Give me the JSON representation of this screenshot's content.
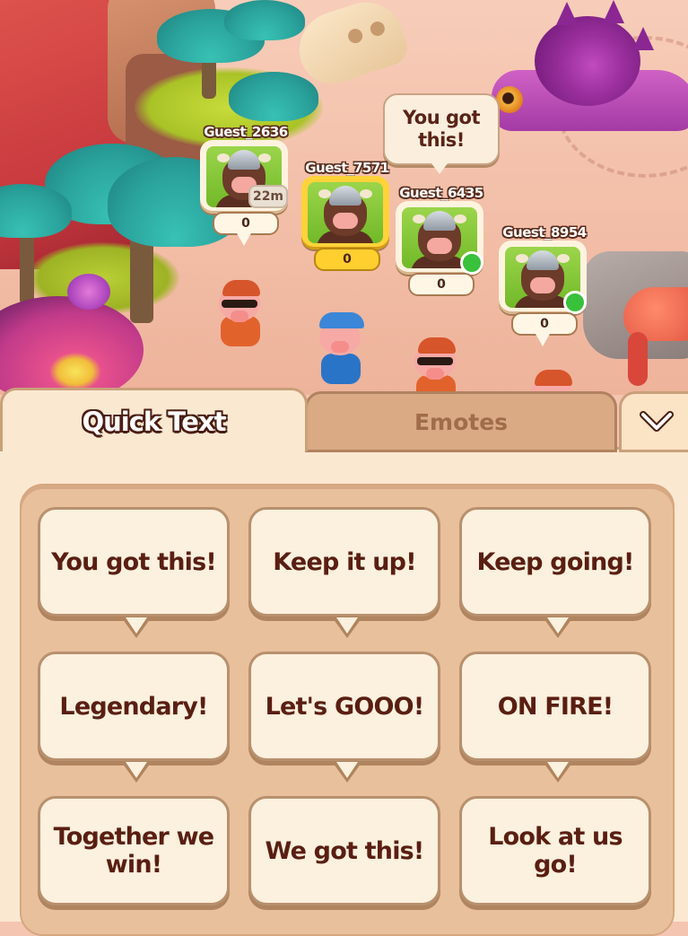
{
  "scene": {
    "speech_bubble": "You got this!",
    "players": [
      {
        "name": "Guest_2636",
        "score": "0",
        "timer": "22m",
        "online": false,
        "highlight": false
      },
      {
        "name": "Guest_7571",
        "score": "0",
        "timer": null,
        "online": false,
        "highlight": true
      },
      {
        "name": "Guest_6435",
        "score": "0",
        "timer": null,
        "online": true,
        "highlight": false
      },
      {
        "name": "Guest_8954",
        "score": "0",
        "timer": null,
        "online": true,
        "highlight": false
      }
    ]
  },
  "chat_panel": {
    "tabs": [
      {
        "label": "Quick Text",
        "active": true
      },
      {
        "label": "Emotes",
        "active": false
      }
    ],
    "collapse_icon": "chevron-down-icon",
    "quick_texts": [
      "You got this!",
      "Keep it up!",
      "Keep going!",
      "Legendary!",
      "Let's GOOO!",
      "ON FIRE!",
      "Together we win!",
      "We got this!",
      "Look at us go!"
    ]
  },
  "colors": {
    "panel_bg": "#fbe8d1",
    "button_bg": "#fcf0de",
    "text_dark": "#5a1e12",
    "highlight_gold": "#ffd23a",
    "online_green": "#39c13b"
  }
}
